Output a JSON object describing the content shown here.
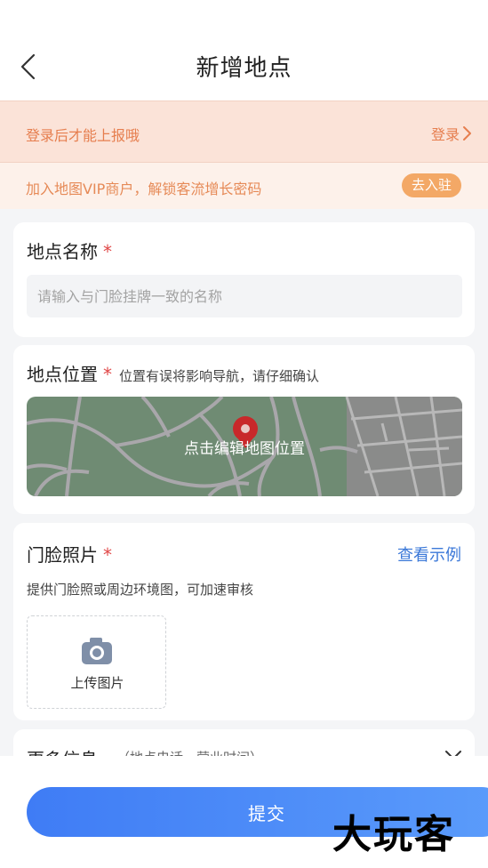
{
  "header": {
    "title": "新增地点",
    "back_icon": "chevron-left-icon"
  },
  "login_banner": {
    "text": "登录后才能上报哦",
    "link_label": "登录",
    "link_icon": "chevron-right-icon",
    "color": "#e67e4e"
  },
  "vip_banner": {
    "text": "加入地图VIP商户，解锁客流增长密码",
    "button_label": "去入驻",
    "button_color": "#f3a866"
  },
  "place_name": {
    "label": "地点名称",
    "required_mark": "*",
    "input_value": "",
    "placeholder": "请输入与门脸挂牌一致的名称"
  },
  "place_location": {
    "label": "地点位置",
    "required_mark": "*",
    "note": "位置有误将影响导航，请仔细确认",
    "map_label": "点击编辑地图位置",
    "pin_icon": "map-pin-icon",
    "pin_color": "#c8282a"
  },
  "storefront_photo": {
    "label": "门脸照片",
    "required_mark": "*",
    "example_link": "查看示例",
    "hint": "提供门脸照或周边环境图，可加速审核",
    "upload_label": "上传图片",
    "upload_icon": "camera-icon"
  },
  "more_info": {
    "label": "更多信息",
    "sub": "（地点电话、营业时间）",
    "expand_icon": "chevron-down-icon"
  },
  "footer": {
    "submit_label": "提交",
    "submit_color": "#3f7cf5"
  },
  "watermark": {
    "text": "大玩客"
  }
}
